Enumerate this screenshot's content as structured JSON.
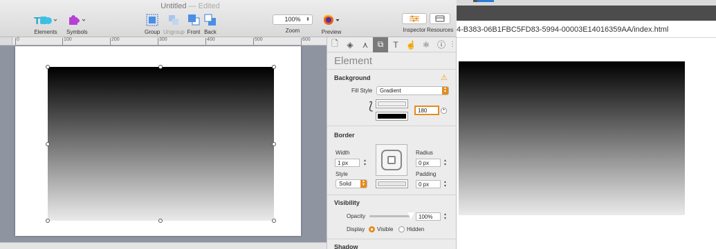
{
  "window": {
    "title": "Untitled",
    "status": "— Edited"
  },
  "toolbar": {
    "elements_label": "Elements",
    "symbols_label": "Symbols",
    "group_label": "Group",
    "ungroup_label": "Ungroup",
    "front_label": "Front",
    "back_label": "Back",
    "zoom_value": "100%",
    "zoom_label": "Zoom",
    "preview_label": "Preview",
    "inspector_label": "Inspector",
    "resources_label": "Resources"
  },
  "ruler": {
    "marks": [
      "0",
      "100",
      "200",
      "300",
      "400",
      "500",
      "600"
    ]
  },
  "inspector": {
    "title": "Element",
    "tabs": [
      "document-icon",
      "layers-icon",
      "typography-icon",
      "shapes-icon",
      "text-icon",
      "hand-icon",
      "atom-icon",
      "info-icon"
    ],
    "background": {
      "title": "Background",
      "fill_style_label": "Fill Style",
      "fill_style_value": "Gradient",
      "angle_value": "180"
    },
    "border": {
      "title": "Border",
      "width_label": "Width",
      "width_value": "1 px",
      "radius_label": "Radius",
      "radius_value": "0 px",
      "style_label": "Style",
      "style_value": "Solid",
      "padding_label": "Padding",
      "padding_value": "0 px"
    },
    "visibility": {
      "title": "Visibility",
      "opacity_label": "Opacity",
      "opacity_value": "100%",
      "opacity_level": 1.0,
      "display_label": "Display",
      "visible_label": "Visible",
      "hidden_label": "Hidden"
    },
    "shadow": {
      "title": "Shadow"
    }
  },
  "browser": {
    "address": "4-B383-06B1FBC5FD83-5994-00003E14016359AA/index.html"
  },
  "colors": {
    "accent": "#e58b1c",
    "gradient_start": "#000000",
    "gradient_end": "#eaeaea"
  }
}
